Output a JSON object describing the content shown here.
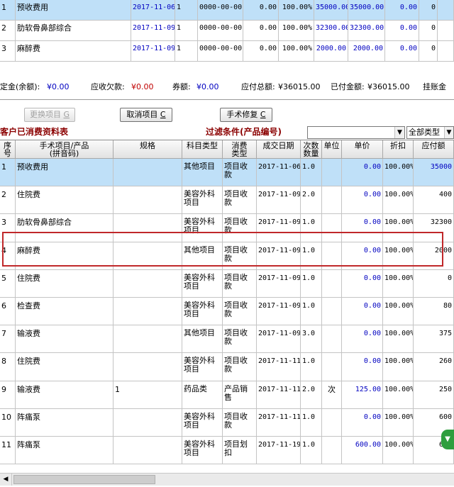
{
  "top_table": {
    "rows": [
      {
        "no": "1",
        "name": "预收费用",
        "date": "2017-11-06",
        "qty": "1",
        "d2": "0000-00-00",
        "v1": "0.00",
        "pct": "100.00%",
        "v2": "35000.00",
        "v3": "35000.00",
        "v4": "0.00",
        "v5": "0",
        "selected": true
      },
      {
        "no": "2",
        "name": "肋软骨鼻部综合",
        "date": "2017-11-09",
        "qty": "1",
        "d2": "0000-00-00",
        "v1": "0.00",
        "pct": "100.00%",
        "v2": "32300.00",
        "v3": "32300.00",
        "v4": "0.00",
        "v5": "0",
        "selected": false
      },
      {
        "no": "3",
        "name": "麻醉费",
        "date": "2017-11-09",
        "qty": "1",
        "d2": "0000-00-00",
        "v1": "0.00",
        "pct": "100.00%",
        "v2": "2000.00",
        "v3": "2000.00",
        "v4": "0.00",
        "v5": "0",
        "selected": false
      }
    ]
  },
  "summary": {
    "deposit_label": "定金(余额):",
    "deposit_value": "¥0.00",
    "receivable_label": "应收欠款:",
    "receivable_value": "¥0.00",
    "coupon_label": "券额:",
    "coupon_value": "¥0.00",
    "total_label": "应付总额:",
    "total_value": "¥36015.00",
    "paid_label": "已付金额:",
    "paid_value": "¥36015.00",
    "hang_label": "挂账金"
  },
  "buttons": {
    "change_item": "更换项目",
    "change_item_key": "G",
    "cancel_item": "取消项目",
    "cancel_item_key": "C",
    "surgery_repair": "手术修复",
    "surgery_repair_key": "C"
  },
  "section": {
    "title": "客户已消费资料表",
    "filter_label": "过滤条件(产品编号)",
    "filter_value": "",
    "type_select": "全部类型"
  },
  "columns": [
    "序号",
    "手术项目/产品\n(拼音码)",
    "规格",
    "科目类型",
    "消费\n类型",
    "成交日期",
    "次数\n数量",
    "单位",
    "单价",
    "折扣",
    "应付额"
  ],
  "rows": [
    {
      "no": "1",
      "name": "预收费用",
      "spec": "",
      "subject": "其他项目",
      "ctype": "项目收款",
      "date": "2017-11-06",
      "qty": "1.0",
      "unit": "",
      "price": "0.00",
      "disc": "100.00%",
      "pay": "35000",
      "selected": true
    },
    {
      "no": "2",
      "name": "住院费",
      "spec": "",
      "subject": "美容外科项目",
      "ctype": "项目收款",
      "date": "2017-11-09",
      "qty": "2.0",
      "unit": "",
      "price": "0.00",
      "disc": "100.00%",
      "pay": "400",
      "selected": false
    },
    {
      "no": "3",
      "name": "肋软骨鼻部综合",
      "spec": "",
      "subject": "美容外科项目",
      "ctype": "项目收款",
      "date": "2017-11-09",
      "qty": "1.0",
      "unit": "",
      "price": "0.00",
      "disc": "100.00%",
      "pay": "32300",
      "selected": false
    },
    {
      "no": "4",
      "name": "麻醉费",
      "spec": "",
      "subject": "其他项目",
      "ctype": "项目收款",
      "date": "2017-11-09",
      "qty": "1.0",
      "unit": "",
      "price": "0.00",
      "disc": "100.00%",
      "pay": "2000",
      "selected": false
    },
    {
      "no": "5",
      "name": "住院费",
      "spec": "",
      "subject": "美容外科项目",
      "ctype": "项目收款",
      "date": "2017-11-09",
      "qty": "1.0",
      "unit": "",
      "price": "0.00",
      "disc": "100.00%",
      "pay": "0",
      "selected": false
    },
    {
      "no": "6",
      "name": "检查费",
      "spec": "",
      "subject": "美容外科项目",
      "ctype": "项目收款",
      "date": "2017-11-09",
      "qty": "1.0",
      "unit": "",
      "price": "0.00",
      "disc": "100.00%",
      "pay": "80",
      "selected": false
    },
    {
      "no": "7",
      "name": "输液费",
      "spec": "",
      "subject": "其他项目",
      "ctype": "项目收款",
      "date": "2017-11-09",
      "qty": "3.0",
      "unit": "",
      "price": "0.00",
      "disc": "100.00%",
      "pay": "375",
      "selected": false
    },
    {
      "no": "8",
      "name": "住院费",
      "spec": "",
      "subject": "美容外科项目",
      "ctype": "项目收款",
      "date": "2017-11-11",
      "qty": "1.0",
      "unit": "",
      "price": "0.00",
      "disc": "100.00%",
      "pay": "260",
      "selected": false
    },
    {
      "no": "9",
      "name": "输液费",
      "spec": "1",
      "subject": "药品类",
      "ctype": "产品销售",
      "date": "2017-11-11",
      "qty": "2.0",
      "unit": "次",
      "price": "125.00",
      "disc": "100.00%",
      "pay": "250",
      "selected": false
    },
    {
      "no": "10",
      "name": "阵痛泵",
      "spec": "",
      "subject": "美容外科项目",
      "ctype": "项目收款",
      "date": "2017-11-11",
      "qty": "1.0",
      "unit": "",
      "price": "0.00",
      "disc": "100.00%",
      "pay": "600",
      "selected": false
    },
    {
      "no": "11",
      "name": "阵痛泵",
      "spec": "",
      "subject": "美容外科项目",
      "ctype": "项目划扣",
      "date": "2017-11-19",
      "qty": "1.0",
      "unit": "",
      "price": "600.00",
      "disc": "100.00%",
      "pay": "600",
      "selected": false
    }
  ],
  "colors": {
    "selected_row": "#bfe0f8",
    "highlight_border": "#c0282a",
    "blue_text": "#0000c0",
    "red_text": "#c00000",
    "title_red": "#8b0000"
  }
}
